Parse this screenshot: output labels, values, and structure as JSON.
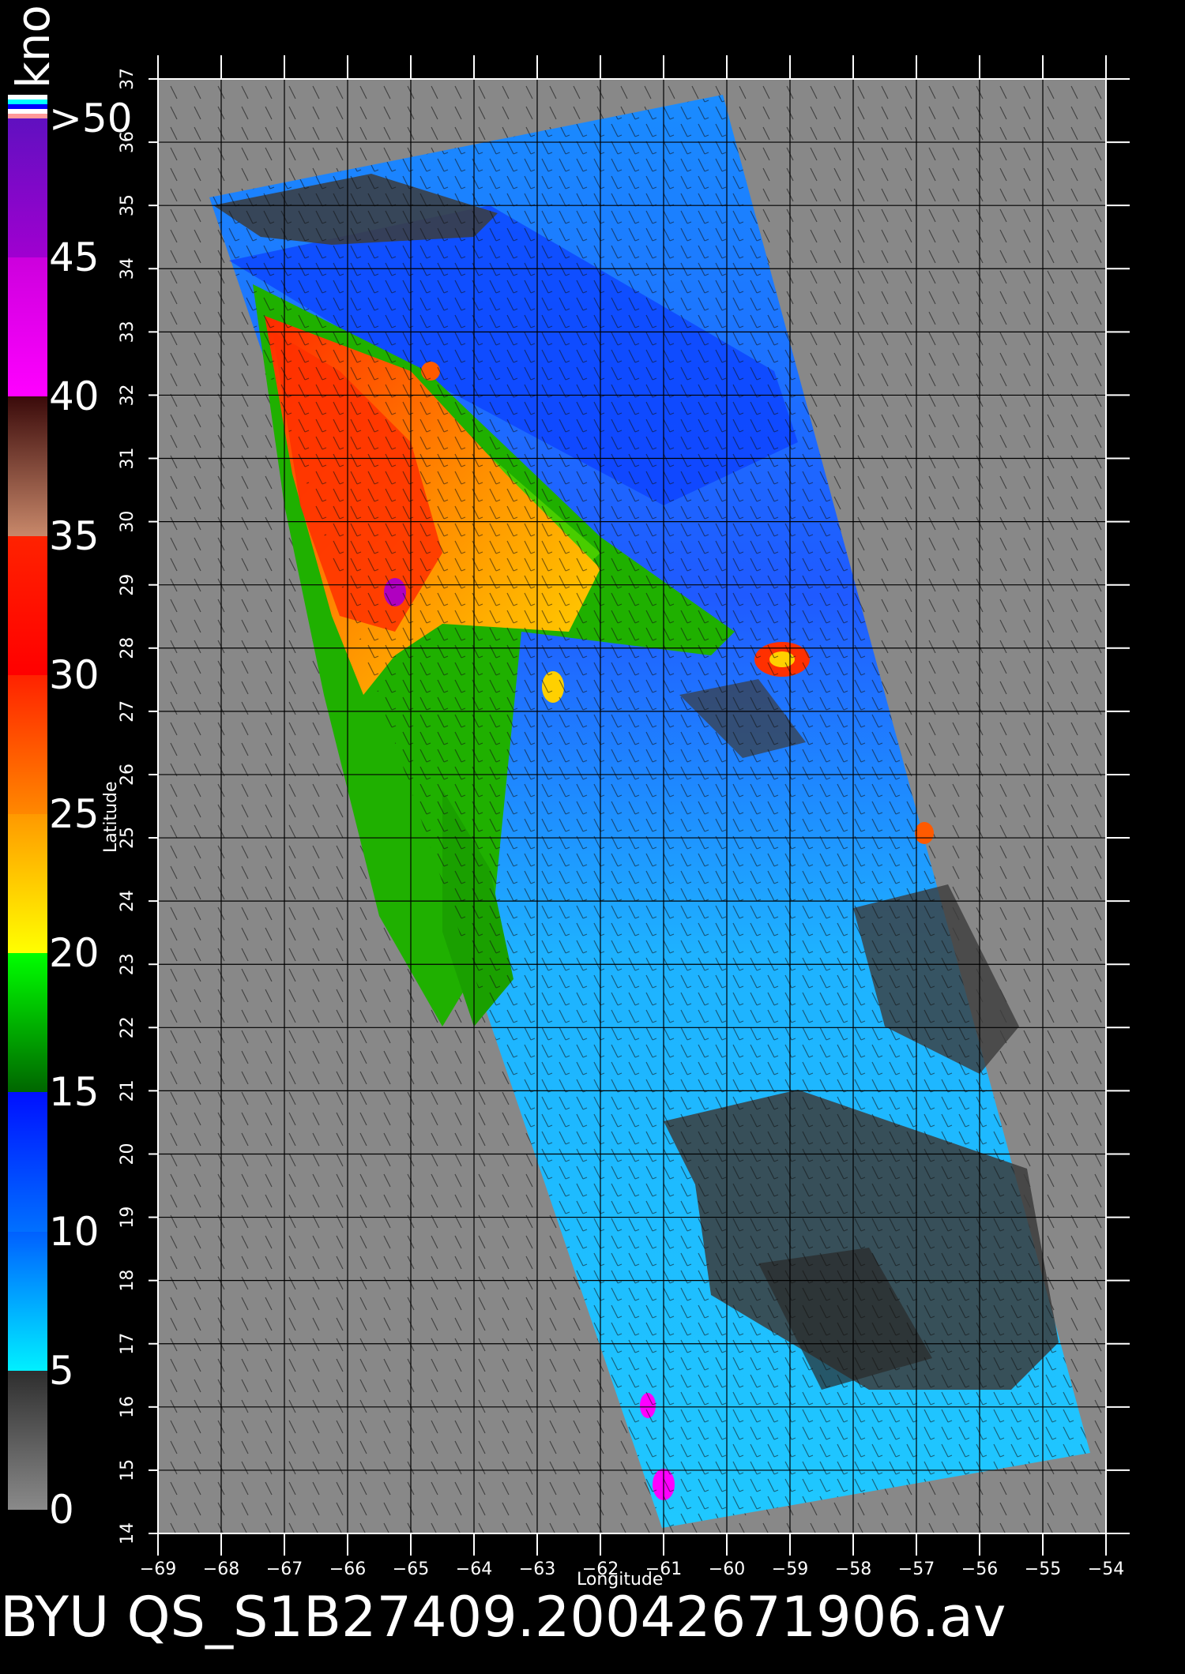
{
  "unit_label": "kno",
  "colorbar": {
    "labels": [
      "0",
      "5",
      "10",
      "15",
      "20",
      "25",
      "30",
      "35",
      "40",
      "45",
      ">50"
    ],
    "segments": [
      {
        "from": 0,
        "to": 5,
        "colors": [
          "#8a8a8a",
          "#2e2e2e"
        ]
      },
      {
        "from": 5,
        "to": 10,
        "colors": [
          "#00f0ff",
          "#0060ff"
        ]
      },
      {
        "from": 10,
        "to": 15,
        "colors": [
          "#0070ff",
          "#0010ff"
        ]
      },
      {
        "from": 15,
        "to": 20,
        "colors": [
          "#006600",
          "#00ff00"
        ]
      },
      {
        "from": 20,
        "to": 25,
        "colors": [
          "#ffff00",
          "#ff9900"
        ]
      },
      {
        "from": 25,
        "to": 30,
        "colors": [
          "#ff8800",
          "#ff2200"
        ]
      },
      {
        "from": 30,
        "to": 35,
        "colors": [
          "#ff0000",
          "#ff2200"
        ]
      },
      {
        "from": 35,
        "to": 40,
        "colors": [
          "#c8886a",
          "#3a0a0a"
        ]
      },
      {
        "from": 40,
        "to": 45,
        "colors": [
          "#ff00ff",
          "#cc00dd"
        ]
      },
      {
        "from": 45,
        "to": 50,
        "colors": [
          "#a000d0",
          "#6010c0"
        ]
      }
    ],
    "top_swatches": [
      "#ffffff",
      "#00ffff",
      "#0000ff",
      "#ffffff",
      "#ff9999"
    ]
  },
  "map": {
    "xlabel": "Longitude",
    "ylabel": "Latitude",
    "lon_ticks": [
      "−69",
      "−68",
      "−67",
      "−66",
      "−65",
      "−64",
      "−63",
      "−62",
      "−61",
      "−60",
      "−59",
      "−58",
      "−57",
      "−56",
      "−55",
      "−54"
    ],
    "lat_ticks": [
      "14",
      "15",
      "16",
      "17",
      "18",
      "19",
      "20",
      "21",
      "22",
      "23",
      "24",
      "25",
      "26",
      "27",
      "28",
      "29",
      "30",
      "31",
      "32",
      "33",
      "34",
      "35",
      "36",
      "37"
    ],
    "background_color": "#888888",
    "grid_color": "#000000"
  },
  "footer_text": "BYU  QS_S1B27409.20042671906.av"
}
